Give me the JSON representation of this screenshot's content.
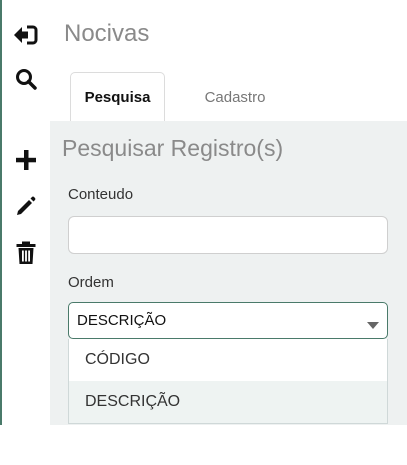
{
  "app": {
    "title": "Nocivas"
  },
  "toolbar": {
    "items": [
      {
        "name": "sign-out-icon",
        "color": "#111111"
      },
      {
        "name": "search-icon",
        "color": "#111111"
      },
      {
        "name": "plus-icon",
        "color": "#111111"
      },
      {
        "name": "pencil-icon",
        "color": "#111111"
      },
      {
        "name": "trash-icon",
        "color": "#111111"
      }
    ]
  },
  "tabs": [
    {
      "label": "Pesquisa",
      "active": true
    },
    {
      "label": "Cadastro",
      "active": false
    }
  ],
  "search_panel": {
    "title": "Pesquisar Registro(s)",
    "content_label": "Conteudo",
    "content_value": "",
    "order_label": "Ordem",
    "order_selected": "DESCRIÇÃO",
    "order_options": [
      "CÓDIGO",
      "DESCRIÇÃO"
    ]
  },
  "colors": {
    "accent": "#4a7a6a",
    "panel_bg": "#eef1f1",
    "title_gray": "#8a8a8a"
  }
}
